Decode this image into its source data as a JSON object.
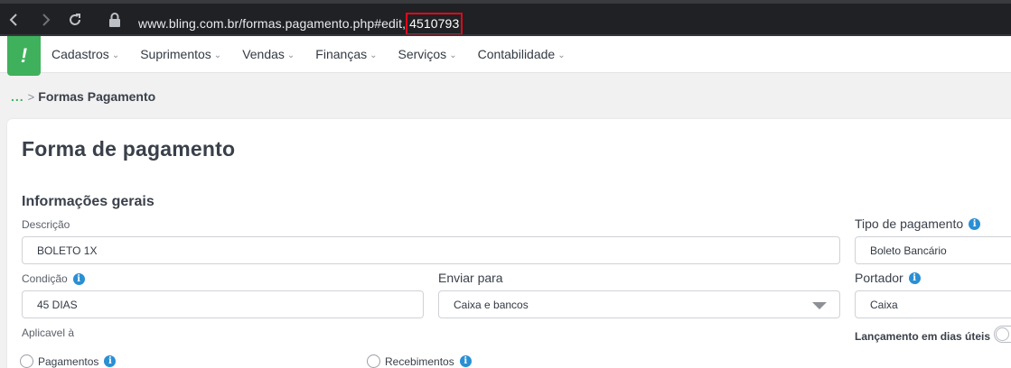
{
  "browser": {
    "url_prefix": "www.bling.com.br/formas.pagamento.php#edit,",
    "url_highlight": "4510793"
  },
  "nav": {
    "logo": "!",
    "items": [
      {
        "label": "Cadastros"
      },
      {
        "label": "Suprimentos"
      },
      {
        "label": "Vendas"
      },
      {
        "label": "Finanças"
      },
      {
        "label": "Serviços"
      },
      {
        "label": "Contabilidade"
      }
    ],
    "chevron": "⌄"
  },
  "breadcrumb": {
    "dots": "...",
    "separator": ">",
    "current": "Formas Pagamento"
  },
  "page": {
    "title": "Forma de pagamento",
    "section": "Informações gerais"
  },
  "form": {
    "descricao_label": "Descrição",
    "descricao_value": "BOLETO 1X",
    "tipo_label": "Tipo de pagamento",
    "tipo_value": "Boleto Bancário",
    "condicao_label": "Condição",
    "condicao_value": "45 DIAS",
    "enviar_label": "Enviar para",
    "enviar_value": "Caixa e bancos",
    "portador_label": "Portador",
    "portador_value": "Caixa",
    "aplicavel_label": "Aplicavel à",
    "lancamento_label": "Lançamento em dias úteis",
    "radio_pagamentos": "Pagamentos",
    "radio_recebimentos": "Recebimentos",
    "info_glyph": "i"
  },
  "colors": {
    "brand_green": "#3fb15c",
    "info_blue": "#2a8fd4",
    "highlight_red": "#e0081b"
  }
}
